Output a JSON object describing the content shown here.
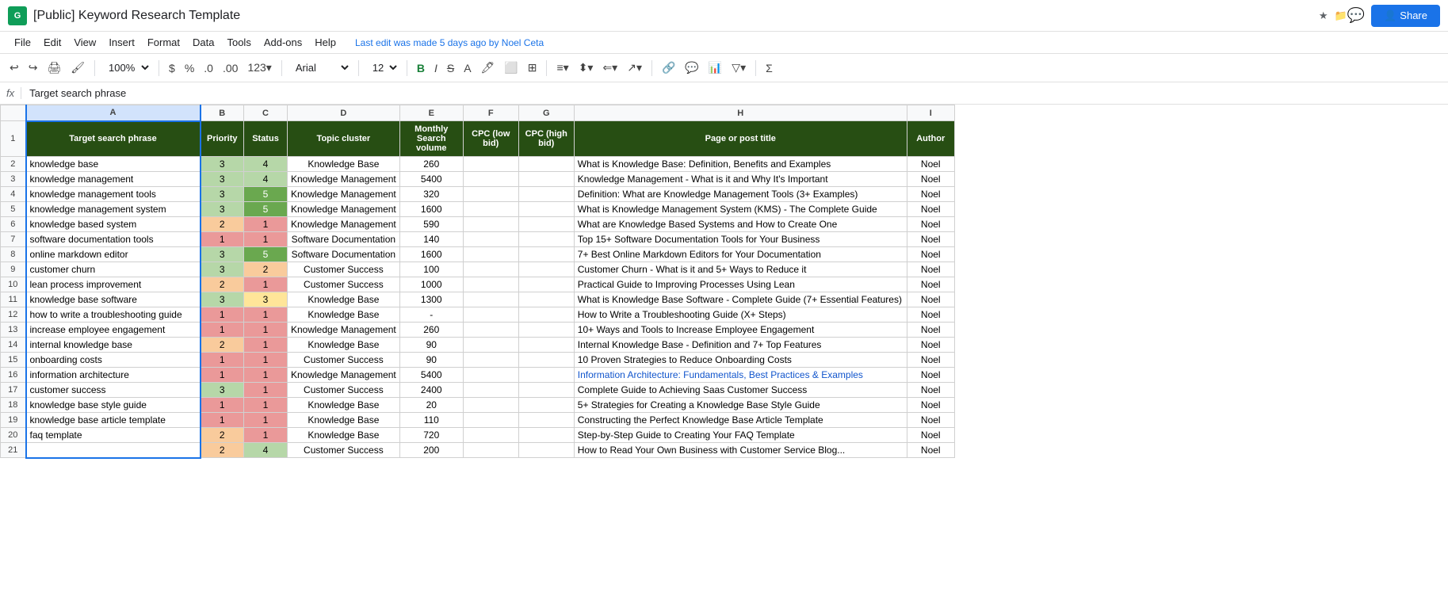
{
  "titleBar": {
    "appIcon": "G",
    "title": "[Public] Keyword Research Template",
    "starIcon": "★",
    "folderIcon": "📁",
    "chatIcon": "💬",
    "shareLabel": "Share",
    "lastEdit": "Last edit was made 5 days ago by Noel Ceta"
  },
  "menuBar": {
    "items": [
      "File",
      "Edit",
      "View",
      "Insert",
      "Format",
      "Data",
      "Tools",
      "Add-ons",
      "Help"
    ]
  },
  "toolbar": {
    "zoom": "100%",
    "currency": "$",
    "percent": "%",
    "decimal0": ".0",
    "decimal00": ".00",
    "format123": "123",
    "font": "Arial",
    "fontSize": "12",
    "bold": "B",
    "italic": "I",
    "strike": "S",
    "textA": "A"
  },
  "formulaBar": {
    "icon": "fx",
    "value": "Target search phrase"
  },
  "columns": {
    "headers": [
      "",
      "A",
      "B",
      "C",
      "D",
      "E",
      "F",
      "G",
      "H",
      "I"
    ],
    "widths": [
      32,
      220,
      55,
      55,
      120,
      80,
      70,
      70,
      420,
      60
    ]
  },
  "tableHeaders": {
    "A": "Target search phrase",
    "B": "Priority",
    "C": "Status",
    "D": "Topic cluster",
    "E": "Monthly\nSearch\nvolume",
    "F": "CPC (low\nbid)",
    "G": "CPC (high\nbid)",
    "H": "Page or post title",
    "I": "Author"
  },
  "rows": [
    {
      "num": 2,
      "A": "knowledge base",
      "B": "3",
      "Bclass": "pri-3",
      "C": "4",
      "Cclass": "sta-4",
      "D": "Knowledge Base",
      "E": "260",
      "F": "",
      "G": "",
      "H": "What is Knowledge Base: Definition, Benefits and Examples",
      "I": "Noel"
    },
    {
      "num": 3,
      "A": "knowledge management",
      "B": "3",
      "Bclass": "pri-3",
      "C": "4",
      "Cclass": "sta-4",
      "D": "Knowledge Management",
      "E": "5400",
      "F": "",
      "G": "",
      "H": "Knowledge Management - What is it and Why It's Important",
      "I": "Noel"
    },
    {
      "num": 4,
      "A": "knowledge management tools",
      "B": "3",
      "Bclass": "pri-3",
      "C": "5",
      "Cclass": "sta-5",
      "D": "Knowledge Management",
      "E": "320",
      "F": "",
      "G": "",
      "H": "Definition: What are Knowledge Management Tools (3+ Examples)",
      "I": "Noel"
    },
    {
      "num": 5,
      "A": "knowledge management system",
      "B": "3",
      "Bclass": "pri-3",
      "C": "5",
      "Cclass": "sta-5",
      "D": "Knowledge Management",
      "E": "1600",
      "F": "",
      "G": "",
      "H": "What is Knowledge Management System (KMS) - The Complete Guide",
      "I": "Noel"
    },
    {
      "num": 6,
      "A": "knowledge based system",
      "B": "2",
      "Bclass": "pri-2",
      "C": "1",
      "Cclass": "sta-1",
      "D": "Knowledge Management",
      "E": "590",
      "F": "",
      "G": "",
      "H": "What are Knowledge Based Systems and How to Create One",
      "I": "Noel"
    },
    {
      "num": 7,
      "A": "software documentation tools",
      "B": "1",
      "Bclass": "pri-1",
      "C": "1",
      "Cclass": "sta-1",
      "D": "Software Documentation",
      "E": "140",
      "F": "",
      "G": "",
      "H": "Top 15+ Software Documentation Tools for Your Business",
      "I": "Noel"
    },
    {
      "num": 8,
      "A": "online markdown editor",
      "B": "3",
      "Bclass": "pri-3",
      "C": "5",
      "Cclass": "sta-5",
      "D": "Software Documentation",
      "E": "1600",
      "F": "",
      "G": "",
      "H": "7+ Best Online Markdown Editors for Your Documentation",
      "I": "Noel"
    },
    {
      "num": 9,
      "A": "customer churn",
      "B": "3",
      "Bclass": "pri-3",
      "C": "2",
      "Cclass": "sta-2",
      "D": "Customer Success",
      "E": "100",
      "F": "",
      "G": "",
      "H": "Customer Churn - What is it and 5+ Ways to Reduce it",
      "I": "Noel"
    },
    {
      "num": 10,
      "A": "lean process improvement",
      "B": "2",
      "Bclass": "pri-2",
      "C": "1",
      "Cclass": "sta-1",
      "D": "Customer Success",
      "E": "1000",
      "F": "",
      "G": "",
      "H": "Practical Guide to Improving Processes Using Lean",
      "I": "Noel"
    },
    {
      "num": 11,
      "A": "knowledge base software",
      "B": "3",
      "Bclass": "pri-3",
      "C": "3",
      "Cclass": "sta-3",
      "D": "Knowledge Base",
      "E": "1300",
      "F": "",
      "G": "",
      "H": "What is Knowledge Base Software - Complete Guide (7+ Essential Features)",
      "I": "Noel"
    },
    {
      "num": 12,
      "A": "how to write a troubleshooting guide",
      "B": "1",
      "Bclass": "pri-1",
      "C": "1",
      "Cclass": "sta-1",
      "D": "Knowledge Base",
      "E": "-",
      "F": "",
      "G": "",
      "H": "How to Write a Troubleshooting Guide (X+ Steps)",
      "I": "Noel"
    },
    {
      "num": 13,
      "A": "increase employee engagement",
      "B": "1",
      "Bclass": "pri-1",
      "C": "1",
      "Cclass": "sta-1",
      "D": "Knowledge Management",
      "E": "260",
      "F": "",
      "G": "",
      "H": "10+ Ways and Tools to Increase Employee Engagement",
      "I": "Noel"
    },
    {
      "num": 14,
      "A": "internal knowledge base",
      "B": "2",
      "Bclass": "pri-2",
      "C": "1",
      "Cclass": "sta-1",
      "D": "Knowledge Base",
      "E": "90",
      "F": "",
      "G": "",
      "H": "Internal Knowledge Base - Definition and 7+ Top Features",
      "I": "Noel"
    },
    {
      "num": 15,
      "A": "onboarding costs",
      "B": "1",
      "Bclass": "pri-1",
      "C": "1",
      "Cclass": "sta-1",
      "D": "Customer Success",
      "E": "90",
      "F": "",
      "G": "",
      "H": "10 Proven Strategies to Reduce Onboarding Costs",
      "I": "Noel"
    },
    {
      "num": 16,
      "A": "information architecture",
      "B": "1",
      "Bclass": "pri-1",
      "C": "1",
      "Cclass": "sta-1",
      "D": "Knowledge Management",
      "E": "5400",
      "F": "",
      "G": "",
      "H": "Information Architecture: Fundamentals, Best Practices & Examples",
      "I": "Noel",
      "Hclass": "link-text"
    },
    {
      "num": 17,
      "A": "customer success",
      "B": "3",
      "Bclass": "pri-3",
      "C": "1",
      "Cclass": "sta-1",
      "D": "Customer Success",
      "E": "2400",
      "F": "",
      "G": "",
      "H": "Complete Guide to Achieving Saas Customer Success",
      "I": "Noel"
    },
    {
      "num": 18,
      "A": "knowledge base style guide",
      "B": "1",
      "Bclass": "pri-1",
      "C": "1",
      "Cclass": "sta-1",
      "D": "Knowledge Base",
      "E": "20",
      "F": "",
      "G": "",
      "H": "5+ Strategies for Creating a Knowledge Base Style Guide",
      "I": "Noel"
    },
    {
      "num": 19,
      "A": "knowledge base article template",
      "B": "1",
      "Bclass": "pri-1",
      "C": "1",
      "Cclass": "sta-1",
      "D": "Knowledge Base",
      "E": "110",
      "F": "",
      "G": "",
      "H": "Constructing the Perfect Knowledge Base Article Template",
      "I": "Noel"
    },
    {
      "num": 20,
      "A": "faq template",
      "B": "2",
      "Bclass": "pri-2",
      "C": "1",
      "Cclass": "sta-1",
      "D": "Knowledge Base",
      "E": "720",
      "F": "",
      "G": "",
      "H": "Step-by-Step Guide to Creating Your FAQ Template",
      "I": "Noel"
    },
    {
      "num": 21,
      "A": "",
      "B": "2",
      "Bclass": "pri-2",
      "C": "4",
      "Cclass": "sta-4",
      "D": "Customer Success",
      "E": "200",
      "F": "",
      "G": "",
      "H": "How to Read Your Own Business with Customer Service Blog...",
      "I": "Noel"
    }
  ]
}
